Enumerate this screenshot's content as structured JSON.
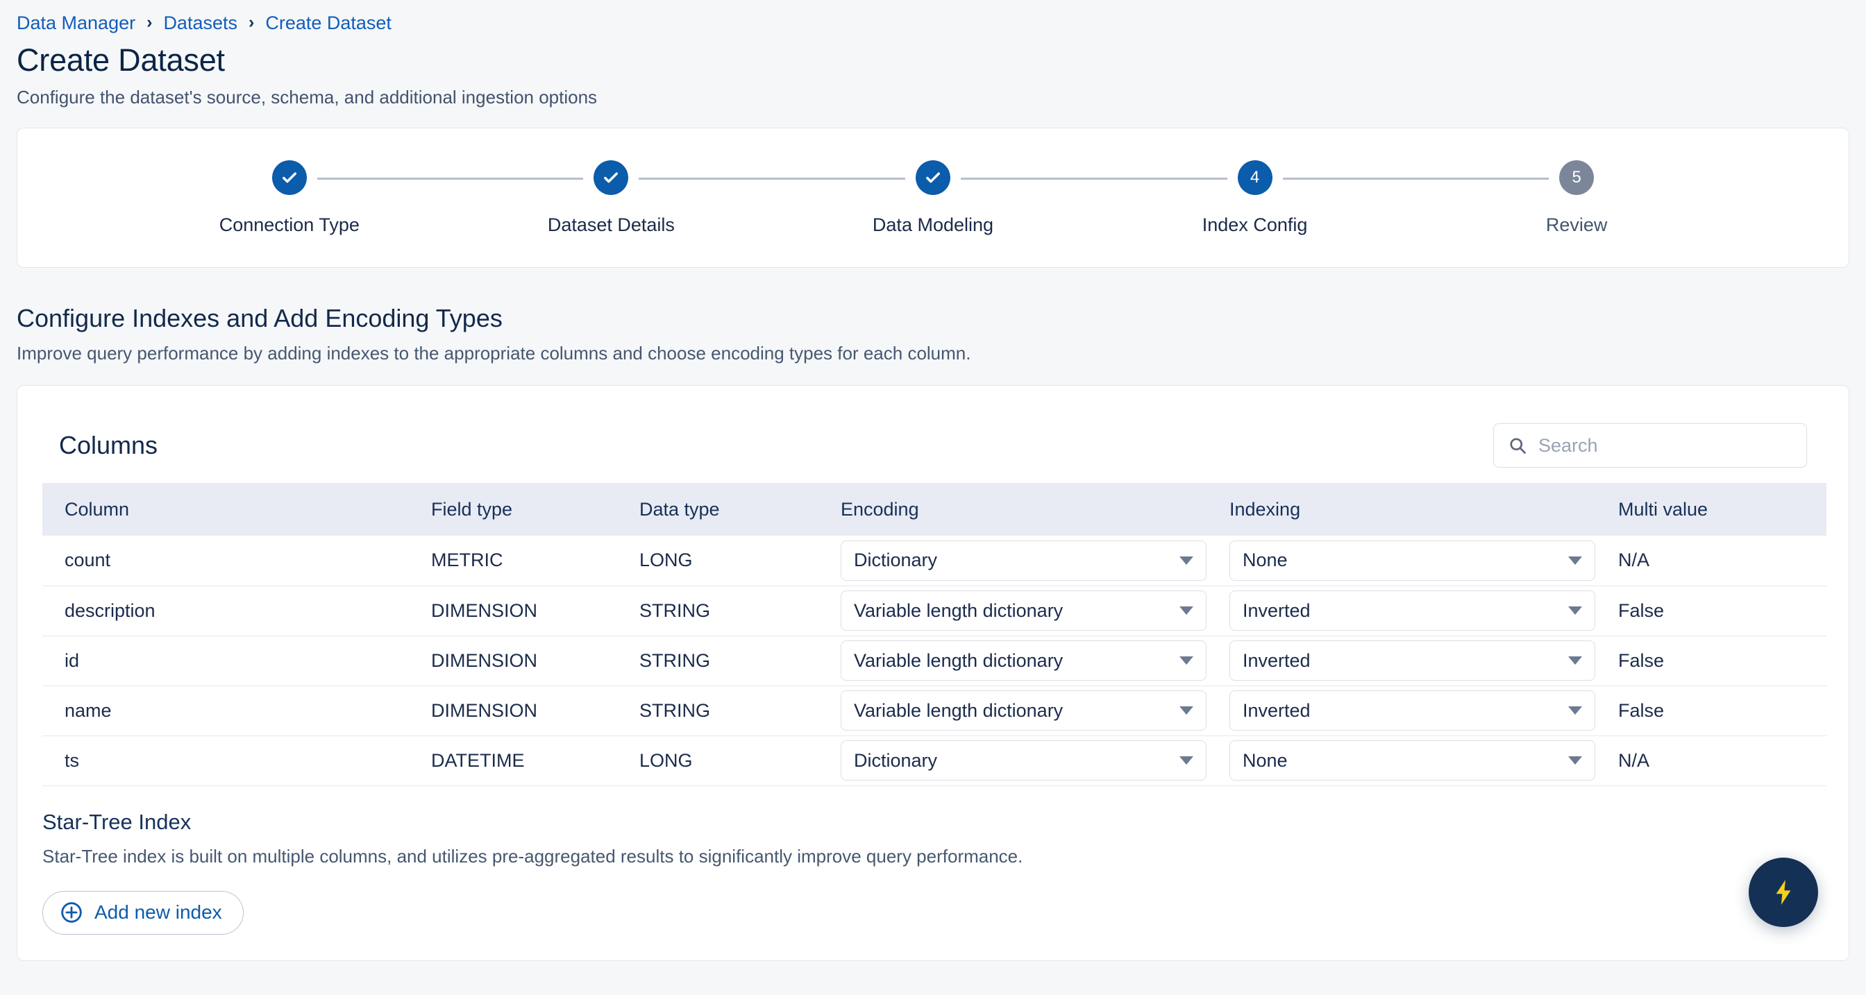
{
  "breadcrumb": {
    "items": [
      "Data Manager",
      "Datasets",
      "Create Dataset"
    ],
    "separator": "›"
  },
  "header": {
    "title": "Create Dataset",
    "subtitle": "Configure the dataset's source, schema, and additional ingestion options"
  },
  "stepper": {
    "steps": [
      {
        "label": "Connection Type",
        "indicator": "✓",
        "state": "done"
      },
      {
        "label": "Dataset Details",
        "indicator": "✓",
        "state": "done"
      },
      {
        "label": "Data Modeling",
        "indicator": "✓",
        "state": "done"
      },
      {
        "label": "Index Config",
        "indicator": "4",
        "state": "active"
      },
      {
        "label": "Review",
        "indicator": "5",
        "state": "todo"
      }
    ]
  },
  "section": {
    "title": "Configure Indexes and Add Encoding Types",
    "subtitle": "Improve query performance by adding indexes to the appropriate columns and choose encoding types for each column."
  },
  "columns_card": {
    "title": "Columns",
    "search": {
      "placeholder": "Search",
      "value": ""
    },
    "table": {
      "headers": [
        "Column",
        "Field type",
        "Data type",
        "Encoding",
        "Indexing",
        "Multi value"
      ],
      "rows": [
        {
          "column": "count",
          "field_type": "METRIC",
          "data_type": "LONG",
          "encoding": "Dictionary",
          "indexing": "None",
          "multi_value": "N/A"
        },
        {
          "column": "description",
          "field_type": "DIMENSION",
          "data_type": "STRING",
          "encoding": "Variable length dictionary",
          "indexing": "Inverted",
          "multi_value": "False"
        },
        {
          "column": "id",
          "field_type": "DIMENSION",
          "data_type": "STRING",
          "encoding": "Variable length dictionary",
          "indexing": "Inverted",
          "multi_value": "False"
        },
        {
          "column": "name",
          "field_type": "DIMENSION",
          "data_type": "STRING",
          "encoding": "Variable length dictionary",
          "indexing": "Inverted",
          "multi_value": "False"
        },
        {
          "column": "ts",
          "field_type": "DATETIME",
          "data_type": "LONG",
          "encoding": "Dictionary",
          "indexing": "None",
          "multi_value": "N/A"
        }
      ]
    }
  },
  "startree": {
    "title": "Star-Tree Index",
    "subtitle": "Star-Tree index is built on multiple columns, and utilizes pre-aggregated results to significantly improve query performance.",
    "add_button_label": "Add new index"
  },
  "fab": {
    "icon": "lightning-bolt-icon"
  },
  "colors": {
    "page_bg": "#f6f7f9",
    "card_bg": "#ffffff",
    "link": "#115dbc",
    "accent": "#0b5cab",
    "step_todo": "#7b8799",
    "table_header_bg": "#e8ebf3",
    "text_primary": "#15284b",
    "text_muted": "#46576f",
    "fab_bg": "#143055",
    "fab_icon": "#f5d020"
  }
}
